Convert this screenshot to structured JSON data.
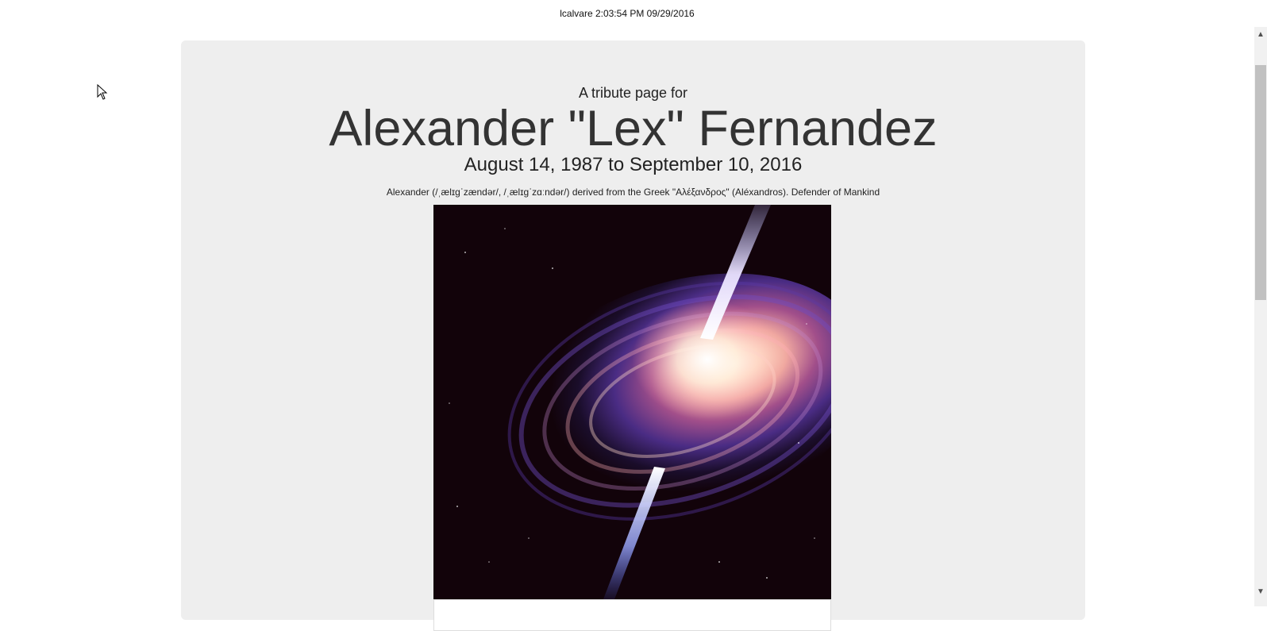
{
  "header": {
    "byline": "lcalvare 2:03:54 PM 09/29/2016"
  },
  "tribute": {
    "pre_title": "A tribute page for",
    "name": "Alexander \"Lex\" Fernandez",
    "dates": "August 14, 1987 to September 10, 2016",
    "meaning": "Alexander (/ˌælɪɡˈzændər/, /ˌælɪɡˈzɑːndər/) derived from the Greek \"Αλέξανδρος\" (Aléxandros). Defender of Mankind",
    "image_subject": "galaxy-quasar-image"
  },
  "scrollbar": {
    "up_icon": "chevron-up-icon",
    "down_icon": "chevron-down-icon"
  },
  "colors": {
    "jumbotron_bg": "#eeeeee",
    "text": "#333333",
    "page_bg": "#ffffff"
  }
}
